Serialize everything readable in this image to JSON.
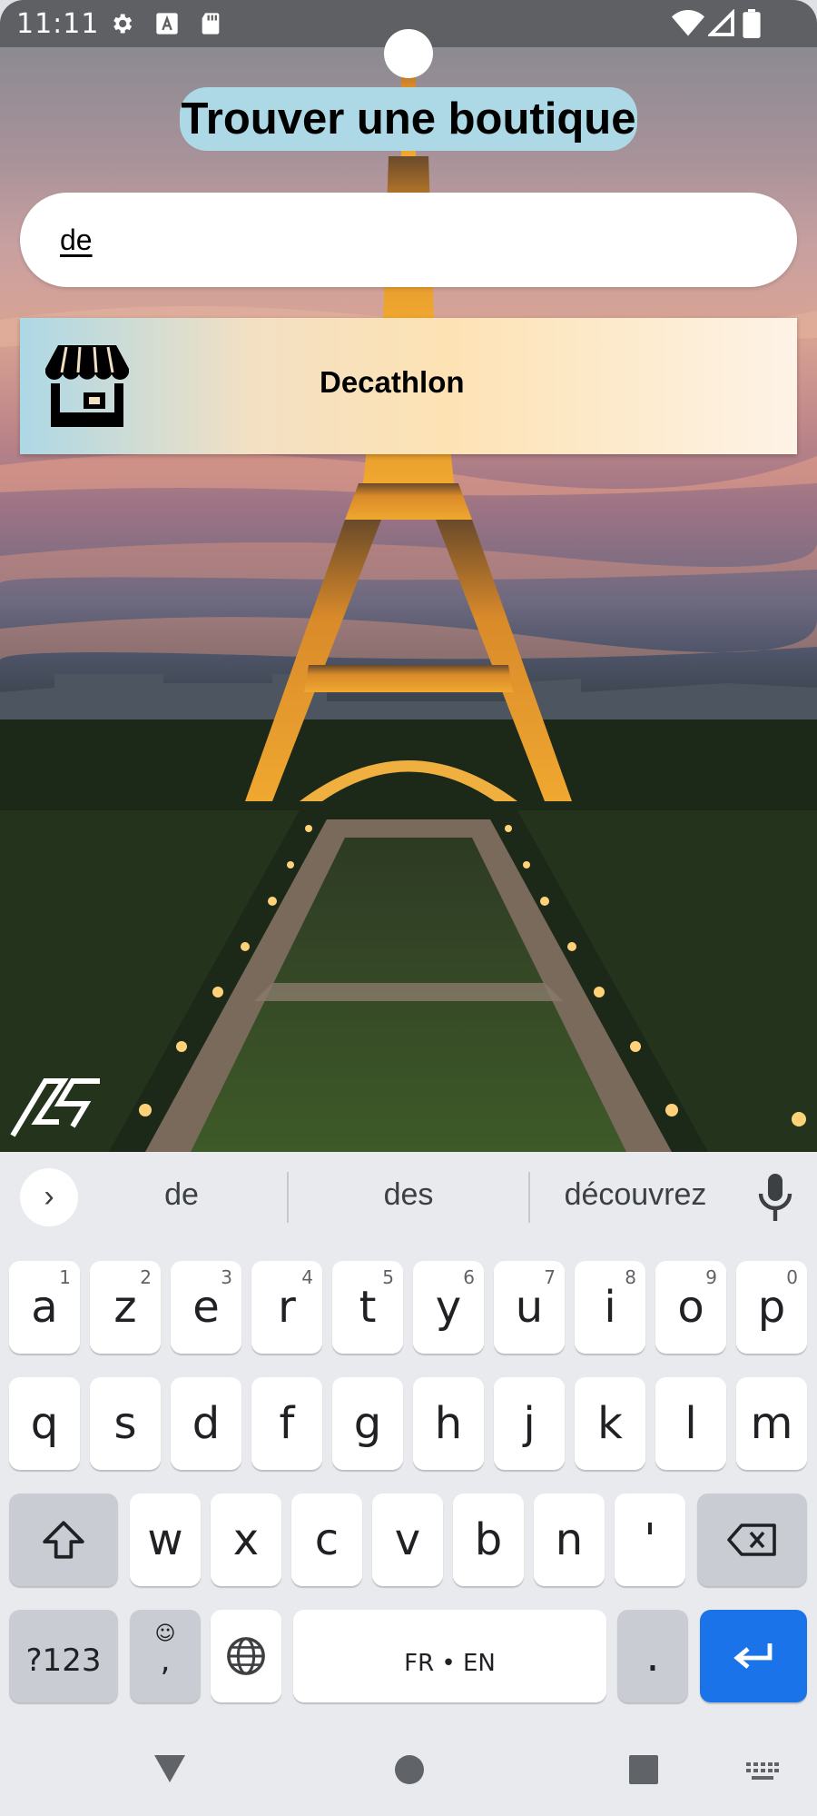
{
  "status_bar": {
    "time": "11:11",
    "left_icons": [
      "settings-icon",
      "font-icon",
      "sd-card-icon"
    ],
    "right_icons": [
      "wifi-icon",
      "signal-icon",
      "battery-icon"
    ]
  },
  "app": {
    "title": "Trouver une boutique",
    "search": {
      "value": "de"
    },
    "results": [
      {
        "label": "Decathlon",
        "icon": "store-icon"
      }
    ]
  },
  "keyboard": {
    "suggestions": [
      "de",
      "des",
      "découvrez"
    ],
    "rows": [
      [
        {
          "label": "a",
          "hint": "1"
        },
        {
          "label": "z",
          "hint": "2"
        },
        {
          "label": "e",
          "hint": "3"
        },
        {
          "label": "r",
          "hint": "4"
        },
        {
          "label": "t",
          "hint": "5"
        },
        {
          "label": "y",
          "hint": "6"
        },
        {
          "label": "u",
          "hint": "7"
        },
        {
          "label": "i",
          "hint": "8"
        },
        {
          "label": "o",
          "hint": "9"
        },
        {
          "label": "p",
          "hint": "0"
        }
      ],
      [
        {
          "label": "q"
        },
        {
          "label": "s"
        },
        {
          "label": "d"
        },
        {
          "label": "f"
        },
        {
          "label": "g"
        },
        {
          "label": "h"
        },
        {
          "label": "j"
        },
        {
          "label": "k"
        },
        {
          "label": "l"
        },
        {
          "label": "m"
        }
      ],
      [
        {
          "label": "w"
        },
        {
          "label": "x"
        },
        {
          "label": "c"
        },
        {
          "label": "v"
        },
        {
          "label": "b"
        },
        {
          "label": "n"
        },
        {
          "label": "'"
        }
      ]
    ],
    "symbols_key": "?123",
    "comma_key": ",",
    "space_label": "FR • EN",
    "period_key": "."
  },
  "colors": {
    "title_bg": "#add8e6",
    "enter_key": "#1a73e8",
    "status_bar": "#5e6063"
  }
}
